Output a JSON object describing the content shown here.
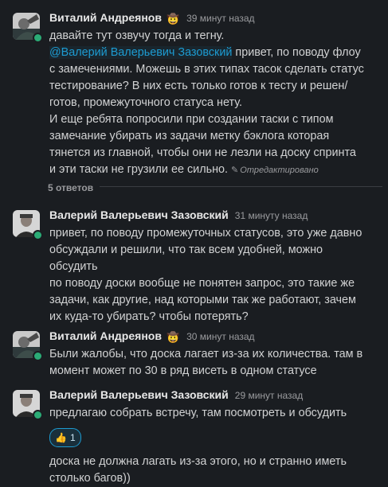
{
  "thread": {
    "parent": {
      "author": "Виталий Андреянов",
      "status_emoji": "🤠",
      "time": "39 минут назад",
      "line1": "давайте тут озвучу тогда и тегну.",
      "mention": "@Валерий Валерьевич Зазовский",
      "line2a": " привет, по поводу флоу",
      "line2b": "с замечениями. Можешь в этих типах тасок сделать статус",
      "line2c": "тестирование? В них есть только готов к тесту и решен/",
      "line2d": "готов, промежуточного статуса нету.",
      "line3a": "И еще ребята попросили при создании таски с типом",
      "line3b": "замечание убирать из задачи метку бэклога которая",
      "line3c": "тянется из главной, чтобы они не лезли на доску спринта",
      "line3d": "и эти таски не грузили ее сильно. ",
      "edited": "Отредактировано"
    },
    "replies_count": "5 ответов",
    "replies": [
      {
        "author": "Валерий Валерьевич Зазовский",
        "time": "31 минуту назад",
        "lines": [
          "привет, по поводу промежуточных статусов, это уже давно",
          "обсуждали и решили, что так всем удобней, можно",
          "обсудить",
          "по поводу доски вообще не понятен запрос, это такие же",
          "задачи, как другие, над которыми так же работают, зачем",
          "их куда-то убирать? чтобы потерять?"
        ]
      },
      {
        "author": "Виталий Андреянов",
        "status_emoji": "🤠",
        "time": "30 минут назад",
        "lines": [
          "Были жалобы, что доска лагает из-за их количества. там в",
          "момент может по 30 в ряд висеть в одном статусе"
        ]
      },
      {
        "author": "Валерий Валерьевич Зазовский",
        "time": "29 минут назад",
        "lines": [
          "предлагаю собрать встречу, там посмотреть и обсудить"
        ],
        "reaction": {
          "emoji": "👍",
          "count": "1"
        },
        "followup": [
          "доска не должна лагать из-за этого, но и странно иметь",
          "столько багов))"
        ]
      }
    ]
  },
  "colors": {
    "background": "#1a1d21",
    "text": "#d1d2d3",
    "mention": "#1d9bd1",
    "presence": "#2bac76",
    "muted": "#9a9b9e"
  }
}
